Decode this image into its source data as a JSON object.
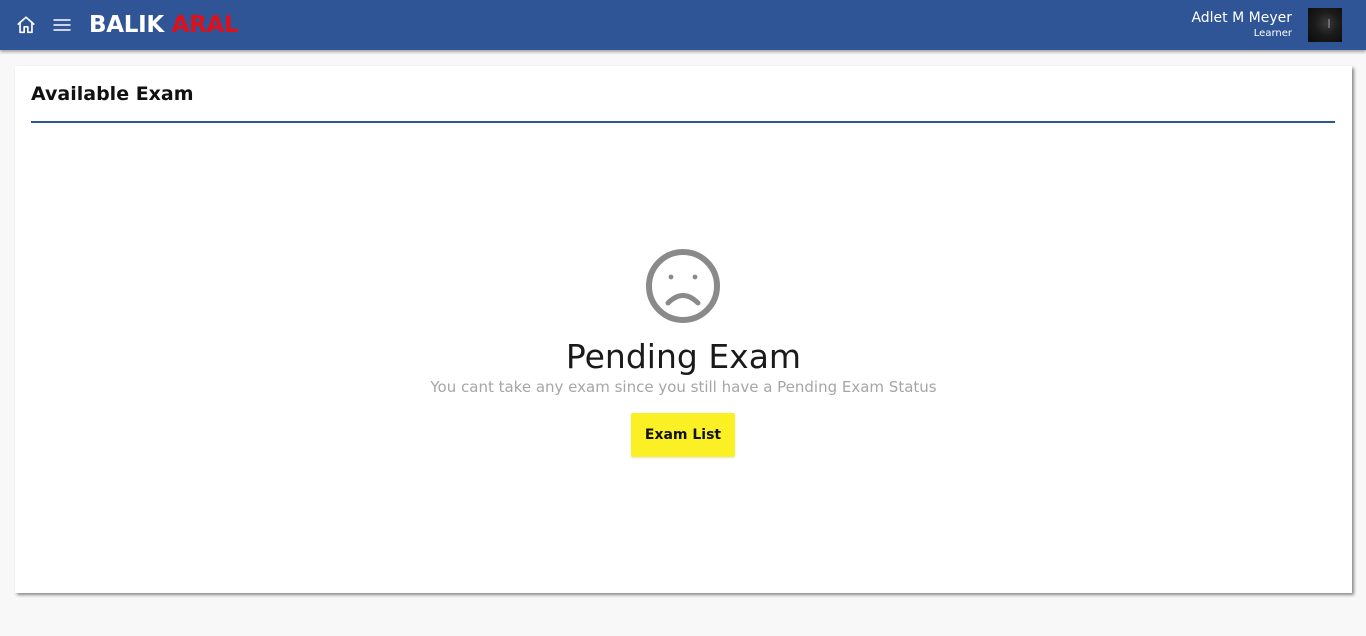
{
  "header": {
    "brand_part1": "BALIK",
    "brand_part2": "ARAL",
    "user_name": "Adlet M Meyer",
    "user_role": "Learner",
    "icons": {
      "home": "home-icon",
      "menu": "hamburger-menu-icon",
      "avatar": "user-avatar"
    }
  },
  "main": {
    "title": "Available Exam",
    "empty_state": {
      "icon": "sad-face-icon",
      "title": "Pending Exam",
      "message": "You cant take any exam since you still have a Pending Exam Status",
      "button_label": "Exam List"
    }
  },
  "colors": {
    "header_bg": "#2f5597",
    "brand_accent": "#e0101a",
    "button_bg": "#fbf023",
    "divider": "#2f5597",
    "muted_text": "#a6a6a6",
    "icon_gray": "#8a8a8a"
  }
}
